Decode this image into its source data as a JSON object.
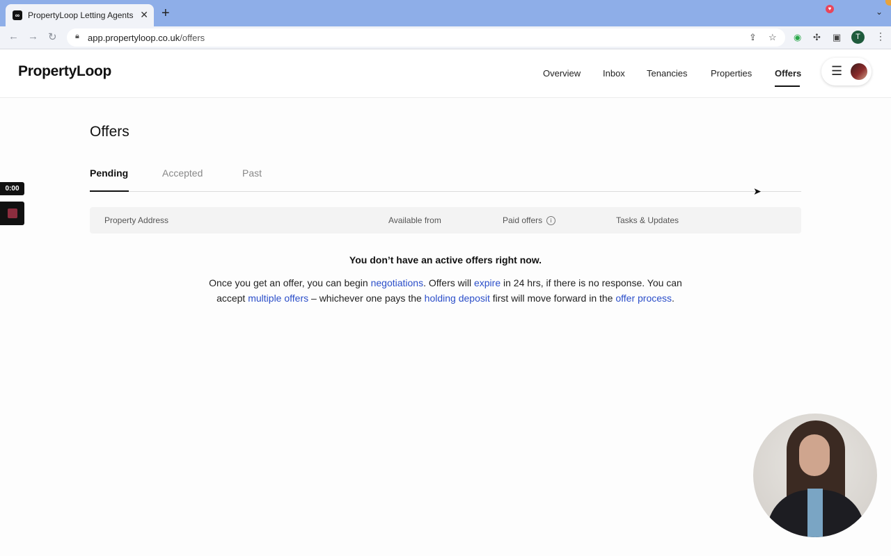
{
  "browser": {
    "tab_title": "PropertyLoop Letting Agents Ir",
    "tab_favicon": "∞",
    "url_domain": "app.propertyloop.co.uk",
    "url_path": "/offers",
    "profile_initial": "T"
  },
  "header": {
    "logo": "PropertyLoop",
    "nav": [
      "Overview",
      "Inbox",
      "Tenancies",
      "Properties",
      "Offers"
    ],
    "active_nav": "Offers"
  },
  "page": {
    "title": "Offers",
    "tabs": [
      "Pending",
      "Accepted",
      "Past"
    ],
    "active_tab": "Pending",
    "table_headers": [
      "Property Address",
      "Available from",
      "Paid offers",
      "Tasks & Updates"
    ],
    "empty_title": "You don’t have an active offers right now.",
    "empty_body": {
      "t1": "Once you get an offer, you can begin ",
      "l1": "negotiations",
      "t2": ". Offers will ",
      "l2": "expire",
      "t3": " in 24 hrs, if there is no response. You can accept ",
      "l3": "multiple offers",
      "t4": " – whichever one pays the ",
      "l4": "holding deposit",
      "t5": " first will move forward in the ",
      "l5": "offer process",
      "t6": "."
    }
  },
  "recording": {
    "timer": "0:00"
  },
  "colors": {
    "link": "#2b4ec9",
    "tabstrip": "#8eaee8",
    "notification": "#e8455a"
  },
  "icons": [
    "back-icon",
    "forward-icon",
    "reload-icon",
    "lock-icon",
    "share-icon",
    "star-icon",
    "extension-icon",
    "puzzle-icon",
    "sidepanel-icon",
    "kebab-menu-icon",
    "hamburger-icon",
    "info-icon",
    "stop-icon",
    "cursor-icon"
  ]
}
